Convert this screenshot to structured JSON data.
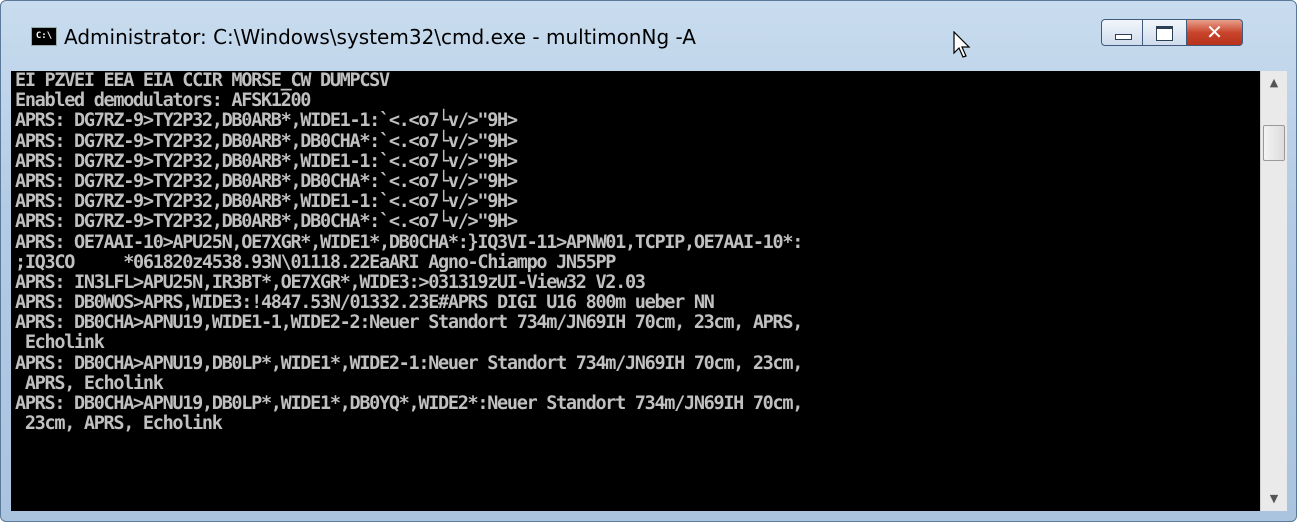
{
  "window": {
    "title": "Administrator: C:\\Windows\\system32\\cmd.exe - multimonNg  -A",
    "icon_label": "C:\\",
    "controls": {
      "minimize": "minimize-icon",
      "maximize": "maximize-icon",
      "close": "close-icon"
    }
  },
  "console": {
    "background": "#000000",
    "foreground": "#c0c0c0",
    "lines": [
      "EI PZVEI EEA EIA CCIR MORSE_CW DUMPCSV",
      "Enabled demodulators: AFSK1200",
      "APRS: DG7RZ-9>TY2P32,DB0ARB*,WIDE1-1:`<.<o7└v/>\"9H>",
      "APRS: DG7RZ-9>TY2P32,DB0ARB*,DB0CHA*:`<.<o7└v/>\"9H>",
      "APRS: DG7RZ-9>TY2P32,DB0ARB*,WIDE1-1:`<.<o7└v/>\"9H>",
      "APRS: DG7RZ-9>TY2P32,DB0ARB*,DB0CHA*:`<.<o7└v/>\"9H>",
      "APRS: DG7RZ-9>TY2P32,DB0ARB*,WIDE1-1:`<.<o7└v/>\"9H>",
      "APRS: DG7RZ-9>TY2P32,DB0ARB*,DB0CHA*:`<.<o7└v/>\"9H>",
      "APRS: OE7AAI-10>APU25N,OE7XGR*,WIDE1*,DB0CHA*:}IQ3VI-11>APNW01,TCPIP,OE7AAI-10*:",
      ";IQ3CO     *061820z4538.93N\\01118.22EaARI Agno-Chiampo JN55PP",
      "APRS: IN3LFL>APU25N,IR3BT*,OE7XGR*,WIDE3:>031319zUI-View32 V2.03",
      "APRS: DB0WOS>APRS,WIDE3:!4847.53N/01332.23E#APRS DIGI U16 800m ueber NN",
      "APRS: DB0CHA>APNU19,WIDE1-1,WIDE2-2:Neuer Standort 734m/JN69IH 70cm, 23cm, APRS,",
      " Echolink",
      "APRS: DB0CHA>APNU19,DB0LP*,WIDE1*,WIDE2-1:Neuer Standort 734m/JN69IH 70cm, 23cm,",
      " APRS, Echolink",
      "APRS: DB0CHA>APNU19,DB0LP*,WIDE1*,DB0YQ*,WIDE2*:Neuer Standort 734m/JN69IH 70cm,",
      " 23cm, APRS, Echolink",
      "",
      ""
    ]
  },
  "scrollbar": {
    "up": "scroll-up-arrow-icon",
    "down": "scroll-down-arrow-icon"
  }
}
